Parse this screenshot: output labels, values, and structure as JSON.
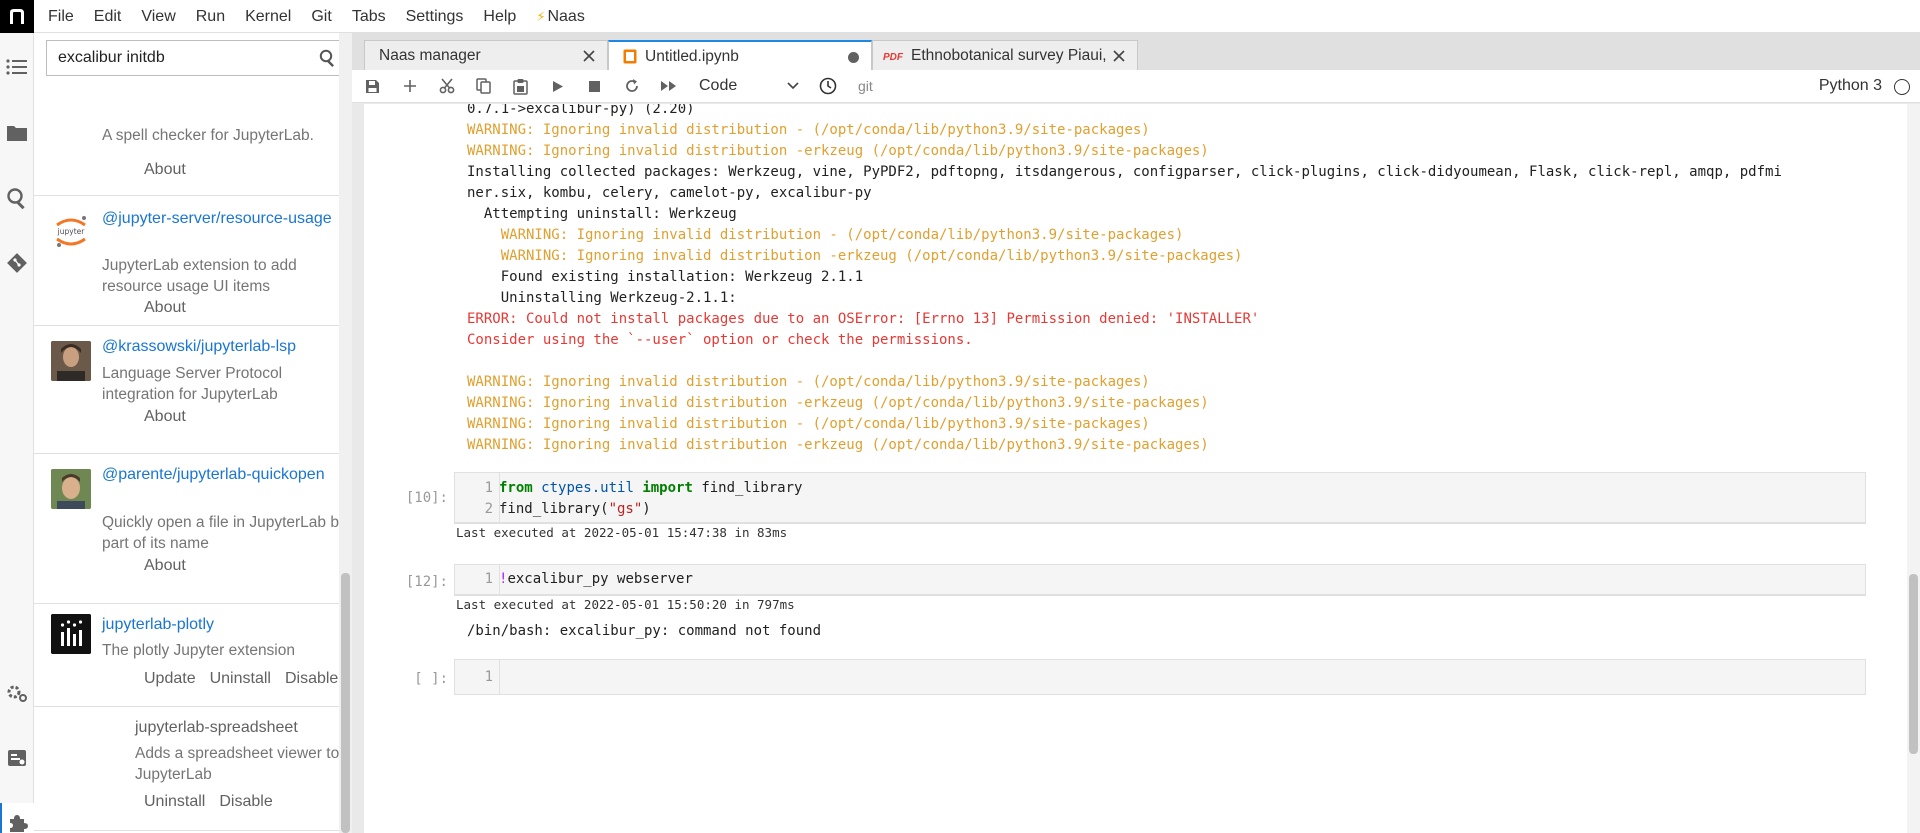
{
  "menu": {
    "items": [
      "File",
      "Edit",
      "View",
      "Run",
      "Kernel",
      "Git",
      "Tabs",
      "Settings",
      "Help",
      "Naas"
    ]
  },
  "colors": {
    "accent": "#1e88e5",
    "link": "#1976d2",
    "warning": "#e0a030",
    "error": "#e53935"
  },
  "sidebar": {
    "search_value": "excalibur initdb",
    "extensions": [
      {
        "name": "",
        "description": "A spell checker for JupyterLab.",
        "actions": [
          "About"
        ]
      },
      {
        "name": "@jupyter-server/resource-usage",
        "description": "JupyterLab extension to add resource usage UI items",
        "actions": [
          "About"
        ],
        "avatar_label": "jupyter"
      },
      {
        "name": "@krassowski/jupyterlab-lsp",
        "description": "Language Server Protocol integration for JupyterLab",
        "actions": [
          "About"
        ]
      },
      {
        "name": "@parente/jupyterlab-quickopen",
        "description": "Quickly open a file in JupyterLab by part of its name",
        "actions": [
          "About"
        ]
      },
      {
        "name": "jupyterlab-plotly",
        "description": "The plotly Jupyter extension",
        "actions": [
          "Update",
          "Uninstall",
          "Disable"
        ]
      },
      {
        "name": "jupyterlab-spreadsheet",
        "description": "Adds a spreadsheet viewer to JupyterLab",
        "actions": [
          "Uninstall",
          "Disable"
        ]
      }
    ]
  },
  "tabs": [
    {
      "label": "Naas manager"
    },
    {
      "label": "Untitled.ipynb"
    },
    {
      "label": "Ethnobotanical survey Piaui,",
      "icon_text": "PDF"
    }
  ],
  "toolbar": {
    "cell_type": "Code",
    "git_label": "git",
    "kernel": "Python 3"
  },
  "output": {
    "lines": [
      {
        "text": "0.7.1->excalibur-py) (2.20)",
        "kind": "normal"
      },
      {
        "text": "WARNING: Ignoring invalid distribution - (/opt/conda/lib/python3.9/site-packages)",
        "kind": "warn"
      },
      {
        "text": "WARNING: Ignoring invalid distribution -erkzeug (/opt/conda/lib/python3.9/site-packages)",
        "kind": "warn"
      },
      {
        "text": "Installing collected packages: Werkzeug, vine, PyPDF2, pdftopng, itsdangerous, configparser, click-plugins, click-didyoumean, Flask, click-repl, amqp, pdfmi",
        "kind": "normal"
      },
      {
        "text": "ner.six, kombu, celery, camelot-py, excalibur-py",
        "kind": "normal"
      },
      {
        "text": "  Attempting uninstall: Werkzeug",
        "kind": "normal"
      },
      {
        "text": "    WARNING: Ignoring invalid distribution - (/opt/conda/lib/python3.9/site-packages)",
        "kind": "warn"
      },
      {
        "text": "    WARNING: Ignoring invalid distribution -erkzeug (/opt/conda/lib/python3.9/site-packages)",
        "kind": "warn"
      },
      {
        "text": "    Found existing installation: Werkzeug 2.1.1",
        "kind": "normal"
      },
      {
        "text": "    Uninstalling Werkzeug-2.1.1:",
        "kind": "normal"
      },
      {
        "text": "ERROR: Could not install packages due to an OSError: [Errno 13] Permission denied: 'INSTALLER'",
        "kind": "err"
      },
      {
        "text": "Consider using the `--user` option or check the permissions.",
        "kind": "err"
      },
      {
        "text": "",
        "kind": "normal"
      },
      {
        "text": "WARNING: Ignoring invalid distribution - (/opt/conda/lib/python3.9/site-packages)",
        "kind": "warn"
      },
      {
        "text": "WARNING: Ignoring invalid distribution -erkzeug (/opt/conda/lib/python3.9/site-packages)",
        "kind": "warn"
      },
      {
        "text": "WARNING: Ignoring invalid distribution - (/opt/conda/lib/python3.9/site-packages)",
        "kind": "warn"
      },
      {
        "text": "WARNING: Ignoring invalid distribution -erkzeug (/opt/conda/lib/python3.9/site-packages)",
        "kind": "warn"
      }
    ]
  },
  "cells": [
    {
      "prompt": "[10]:",
      "line_numbers": [
        "1",
        "2"
      ],
      "code": {
        "l1_from": "from",
        "l1_mod": "ctypes.util",
        "l1_import": "import",
        "l1_name": "find_library",
        "l2_call": "find_library(",
        "l2_str": "\"gs\"",
        "l2_close": ")"
      },
      "executed": "Last executed at 2022-05-01 15:47:38 in 83ms"
    },
    {
      "prompt": "[12]:",
      "line_numbers": [
        "1"
      ],
      "code": {
        "bang": "!",
        "rest": "excalibur_py webserver"
      },
      "executed": "Last executed at 2022-05-01 15:50:20 in 797ms",
      "output": "/bin/bash: excalibur_py: command not found"
    },
    {
      "prompt": "[ ]:",
      "line_numbers": [
        "1"
      ]
    }
  ]
}
